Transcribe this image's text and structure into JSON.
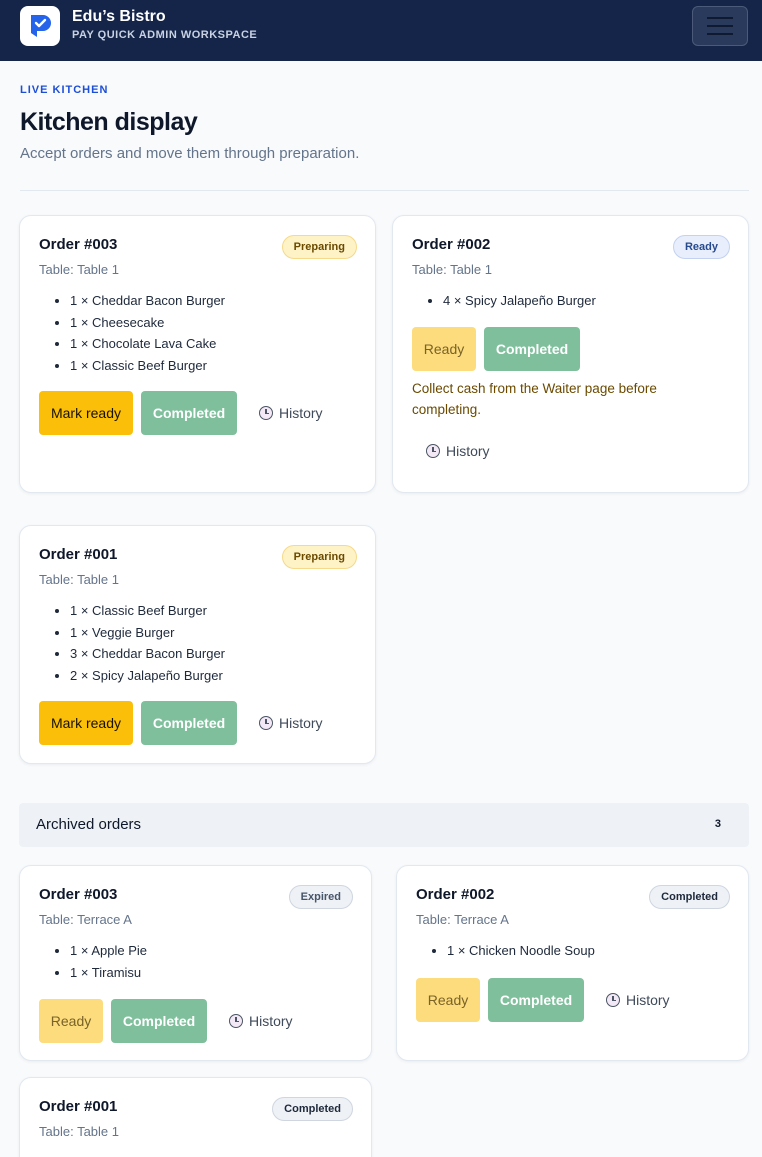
{
  "header": {
    "brand_name": "Edu’s Bistro",
    "brand_sub": "PAY QUICK ADMIN WORKSPACE"
  },
  "page": {
    "eyebrow": "LIVE KITCHEN",
    "title": "Kitchen display",
    "subtitle": "Accept orders and move them through preparation."
  },
  "active_orders": [
    {
      "title": "Order #003",
      "table": "Table: Table 1",
      "status": "Preparing",
      "items": [
        "1 × Cheddar Bacon Burger",
        "1 × Cheesecake",
        "1 × Chocolate Lava Cake",
        "1 × Classic Beef Burger"
      ],
      "primary_button": "Mark ready",
      "complete_button": "Completed",
      "history_label": "History"
    },
    {
      "title": "Order #002",
      "table": "Table: Table 1",
      "status": "Ready",
      "items": [
        "4 × Spicy Jalapeño Burger"
      ],
      "primary_button": "Ready",
      "complete_button": "Completed",
      "note": "Collect cash from the Waiter page before completing.",
      "history_label": "History"
    },
    {
      "title": "Order #001",
      "table": "Table: Table 1",
      "status": "Preparing",
      "items": [
        "1 × Classic Beef Burger",
        "1 × Veggie Burger",
        "3 × Cheddar Bacon Burger",
        "2 × Spicy Jalapeño Burger"
      ],
      "primary_button": "Mark ready",
      "complete_button": "Completed",
      "history_label": "History"
    }
  ],
  "archived": {
    "label": "Archived orders",
    "count": "3",
    "orders": [
      {
        "title": "Order #003",
        "table": "Table: Terrace A",
        "status": "Expired",
        "items": [
          "1 × Apple Pie",
          "1 × Tiramisu"
        ],
        "primary_button": "Ready",
        "complete_button": "Completed",
        "history_label": "History"
      },
      {
        "title": "Order #002",
        "table": "Table: Terrace A",
        "status": "Completed",
        "items": [
          "1 × Chicken Noodle Soup"
        ],
        "primary_button": "Ready",
        "complete_button": "Completed",
        "history_label": "History"
      },
      {
        "title": "Order #001",
        "table": "Table: Table 1",
        "status": "Completed"
      }
    ]
  },
  "colors": {
    "header_bg": "#142549",
    "accent_blue": "#1d4ed8",
    "mark_ready": "#fbbf0a",
    "completed_green": "#7fbf9c"
  }
}
